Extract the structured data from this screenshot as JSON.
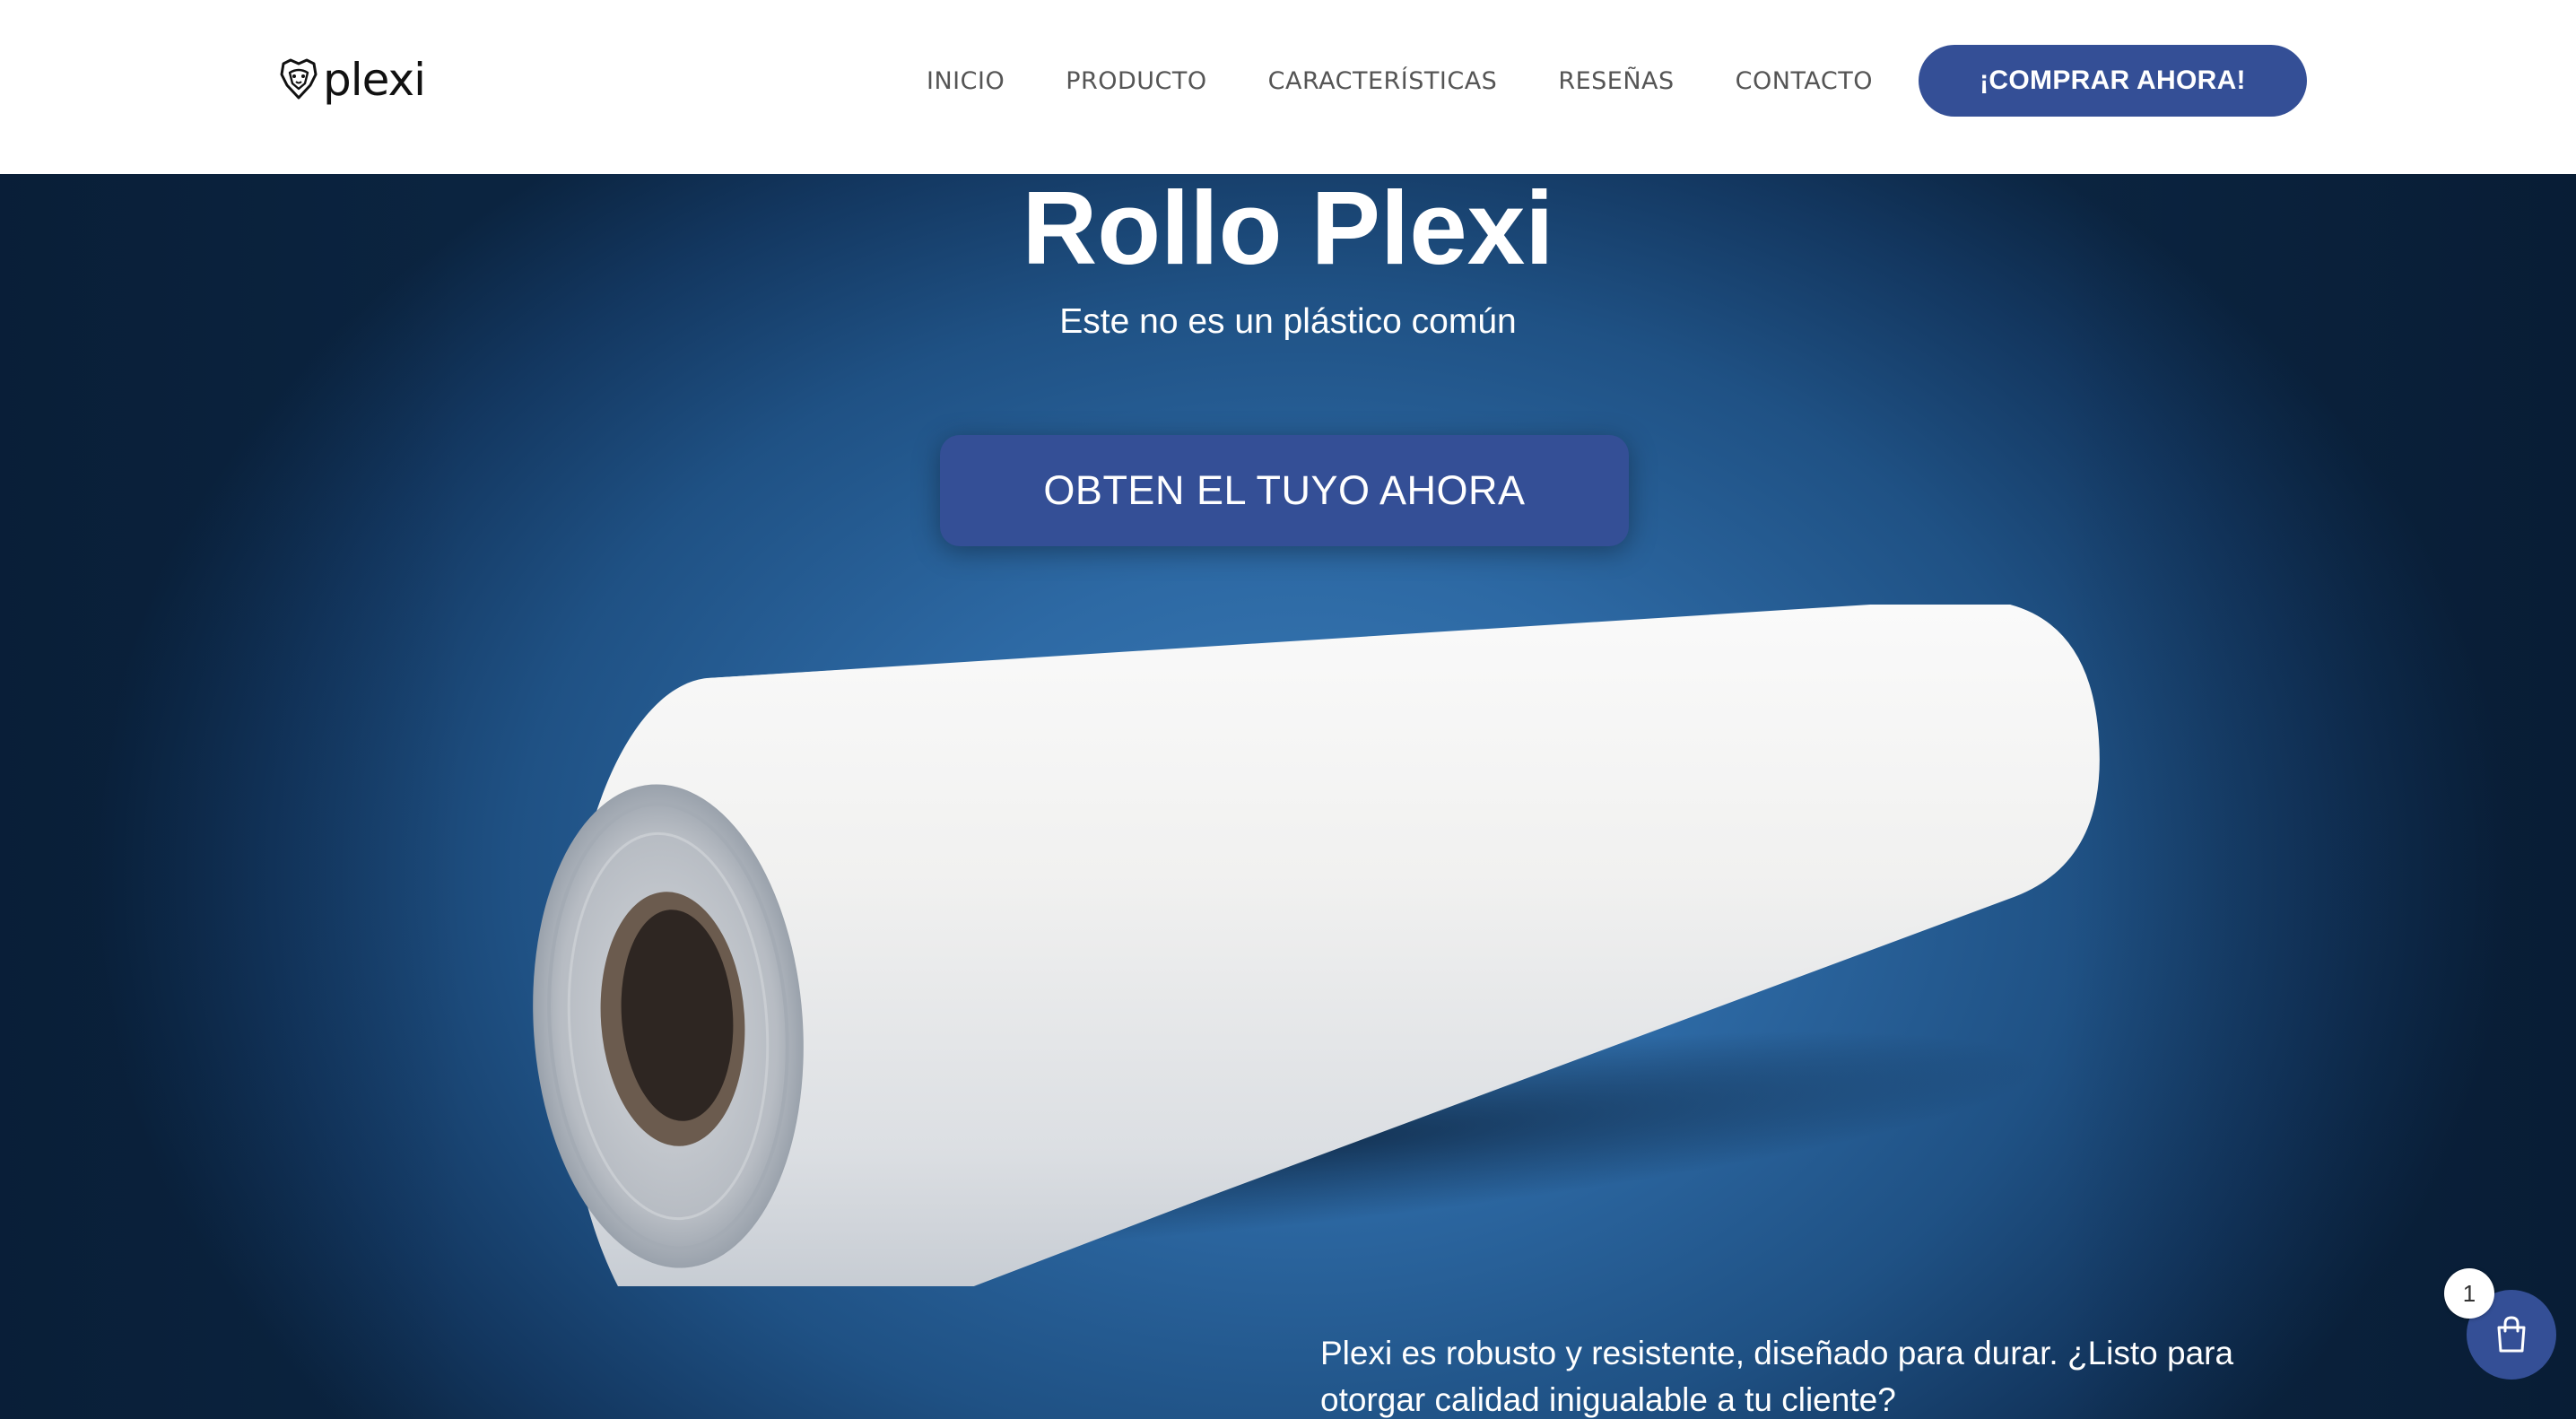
{
  "brand": {
    "logo_text": "plexi",
    "accent_color": "#344f96"
  },
  "nav": {
    "items": [
      {
        "label": "INICIO"
      },
      {
        "label": "PRODUCTO"
      },
      {
        "label": "CARACTERÍSTICAS"
      },
      {
        "label": "RESEÑAS"
      },
      {
        "label": "CONTACTO"
      }
    ],
    "buy_label": "¡COMPRAR AHORA!"
  },
  "hero": {
    "title": "Rollo Plexi",
    "subtitle": "Este no es un plástico común",
    "cta_label": "OBTEN EL TUYO AHORA",
    "paragraph": "Plexi es robusto y resistente, diseñado para durar. ¿Listo para otorgar calidad inigualable a tu cliente?",
    "image_icon": "paper-roll-image"
  },
  "cart": {
    "count": "1",
    "icon": "shopping-bag-icon"
  }
}
